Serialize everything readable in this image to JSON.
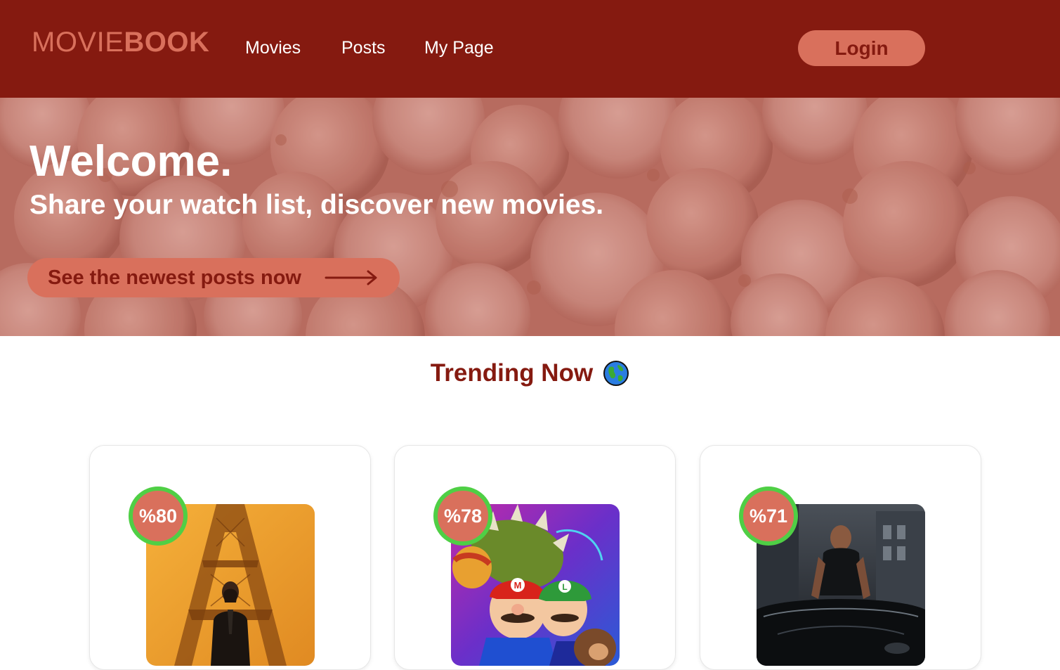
{
  "brand": {
    "logo_light": "MOVIE",
    "logo_bold": "BOOK"
  },
  "nav": {
    "items": [
      {
        "label": "Movies"
      },
      {
        "label": "Posts"
      },
      {
        "label": "My Page"
      }
    ],
    "login_label": "Login"
  },
  "hero": {
    "title": "Welcome.",
    "subtitle": "Share your watch list, discover new movies.",
    "cta_label": "See the newest posts now",
    "cta_icon": "arrow-right-icon",
    "background": "popcorn-image"
  },
  "trending": {
    "title": "Trending Now",
    "icon": "globe-icon"
  },
  "movies": [
    {
      "score": "%80",
      "poster": "eiffel-tower-man-poster"
    },
    {
      "score": "%78",
      "poster": "cartoon-plumbers-poster"
    },
    {
      "score": "%71",
      "poster": "man-with-car-poster"
    }
  ],
  "colors": {
    "primary": "#851a10",
    "accent": "#d9705c",
    "score_ring": "#4fcf45",
    "text_light": "#ffffff"
  }
}
